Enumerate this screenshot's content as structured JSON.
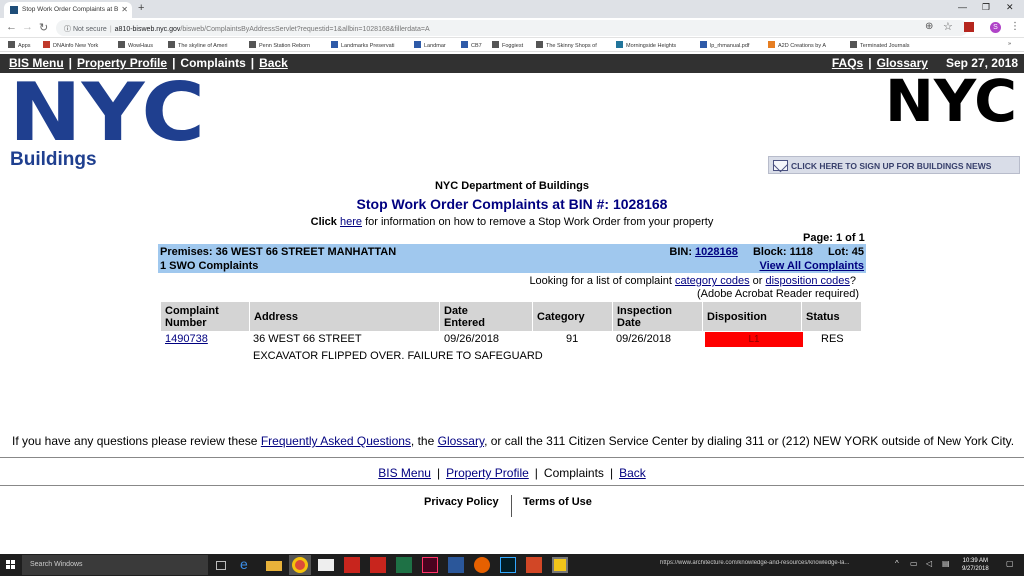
{
  "browser": {
    "tab_title": "Stop Work Order Complaints at B",
    "new_tab": "+",
    "url_prefix": "Not secure",
    "url_host": "a810-bisweb.nyc.gov",
    "url_path": "/bisweb/ComplaintsByAddressServlet?requestid=1&allbin=1028168&fillerdata=A",
    "avatar_letter": "S",
    "bookmarks": [
      "Apps",
      "DNAinfo New York",
      "WowHaus",
      "The skyline of Ameri",
      "Penn Station Reborn",
      "Landmarks Preservati",
      "Landmar",
      "CB7",
      "Foggiest",
      "The Skinny Shops of",
      "Morningside Heights",
      "lp_rhmanual.pdf",
      "A2D Creations by A",
      "Terminated Journals"
    ]
  },
  "bis_nav": {
    "bis_menu": "BIS Menu",
    "property_profile": "Property Profile",
    "complaints": "Complaints",
    "back": "Back",
    "faqs": "FAQs",
    "glossary": "Glossary",
    "date": "Sep 27, 2018",
    "sep": "|"
  },
  "logos": {
    "left": "NYC",
    "right": "NYC",
    "buildings": "Buildings"
  },
  "news_button": "CLICK HERE TO SIGN UP FOR BUILDINGS NEWS",
  "header": {
    "department": "NYC Department of Buildings",
    "title": "Stop Work Order Complaints at BIN #: 1028168",
    "click_word": "Click",
    "here_link": "here",
    "click_rest": "for information on how to remove a Stop Work Order from your property",
    "page": "Page: 1 of 1"
  },
  "premises": {
    "address": "Premises: 36 WEST 66 STREET MANHATTAN",
    "count": "1 SWO Complaints",
    "bin_label": "BIN:",
    "bin_value": "1028168",
    "block": "Block: 1118",
    "lot": "Lot: 45",
    "view_all": "View All Complaints"
  },
  "lookup": {
    "text1": "Looking for a list of complaint",
    "category_codes": "category codes",
    "or": "or",
    "disposition_codes": "disposition codes",
    "q": "?",
    "adobe": "(Adobe Acrobat Reader required)"
  },
  "table": {
    "headers": {
      "complaint_number_1": "Complaint",
      "complaint_number_2": "Number",
      "address": "Address",
      "date_entered_1": "Date",
      "date_entered_2": "Entered",
      "category": "Category",
      "inspection_date_1": "Inspection",
      "inspection_date_2": "Date",
      "disposition": "Disposition",
      "status": "Status"
    },
    "row": {
      "complaint_number": "1490738",
      "address": "36 WEST 66 STREET",
      "date_entered": "09/26/2018",
      "category": "91",
      "inspection_date": "09/26/2018",
      "disposition": "L1",
      "status": "RES",
      "description": "EXCAVATOR FLIPPED OVER. FAILURE TO SAFEGUARD"
    },
    "disposition_color": "#fe0000"
  },
  "footer": {
    "q1": "If you have any questions please review these",
    "faq_link": "Frequently Asked Questions",
    "q2": ", the",
    "glossary_link": "Glossary",
    "q3": ", or call the 311 Citizen Service Center by dialing 311 or (212) NEW YORK outside of New York City.",
    "bis_menu": "BIS Menu",
    "property_profile": "Property Profile",
    "complaints": "Complaints",
    "back": "Back",
    "sep": "|",
    "privacy": "Privacy Policy",
    "terms": "Terms of Use"
  },
  "taskbar": {
    "search": "Search Windows",
    "url": "https://www.architecture.com/knowledge-and-resources/knowledge-la...",
    "time": "10:39 AM",
    "date": "9/27/2018"
  },
  "colors": {
    "nav_bg": "#313131",
    "banner_bg": "#a0c8ee",
    "title_blue": "#000080",
    "logo_blue": "#1f3f8f"
  }
}
